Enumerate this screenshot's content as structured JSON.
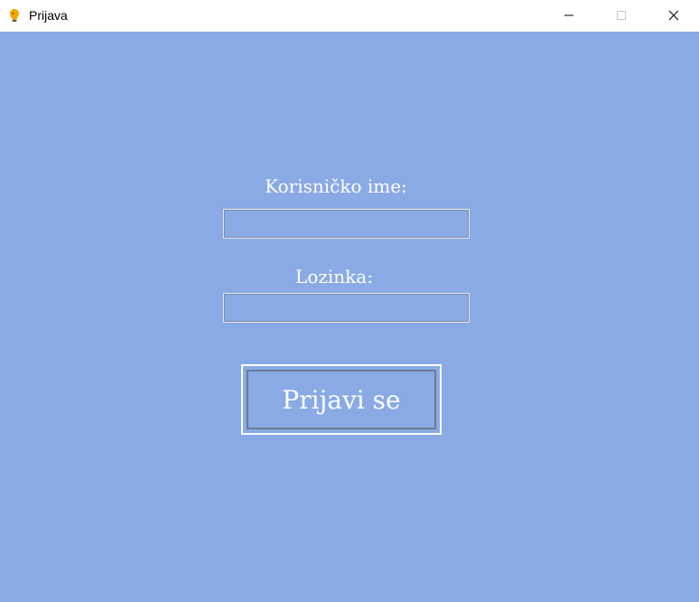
{
  "window": {
    "title": "Prijava",
    "icon": "app-icon",
    "controls": [
      "minimize-icon",
      "maximize-icon",
      "close-icon"
    ]
  },
  "form": {
    "username_label": "Korisničko ime:",
    "username_value": "",
    "password_label": "Lozinka:",
    "password_value": "",
    "login_button": "Prijavi se"
  },
  "colors": {
    "background": "#8aaae5",
    "text": "#ffffff",
    "titlebar": "#ffffff"
  }
}
